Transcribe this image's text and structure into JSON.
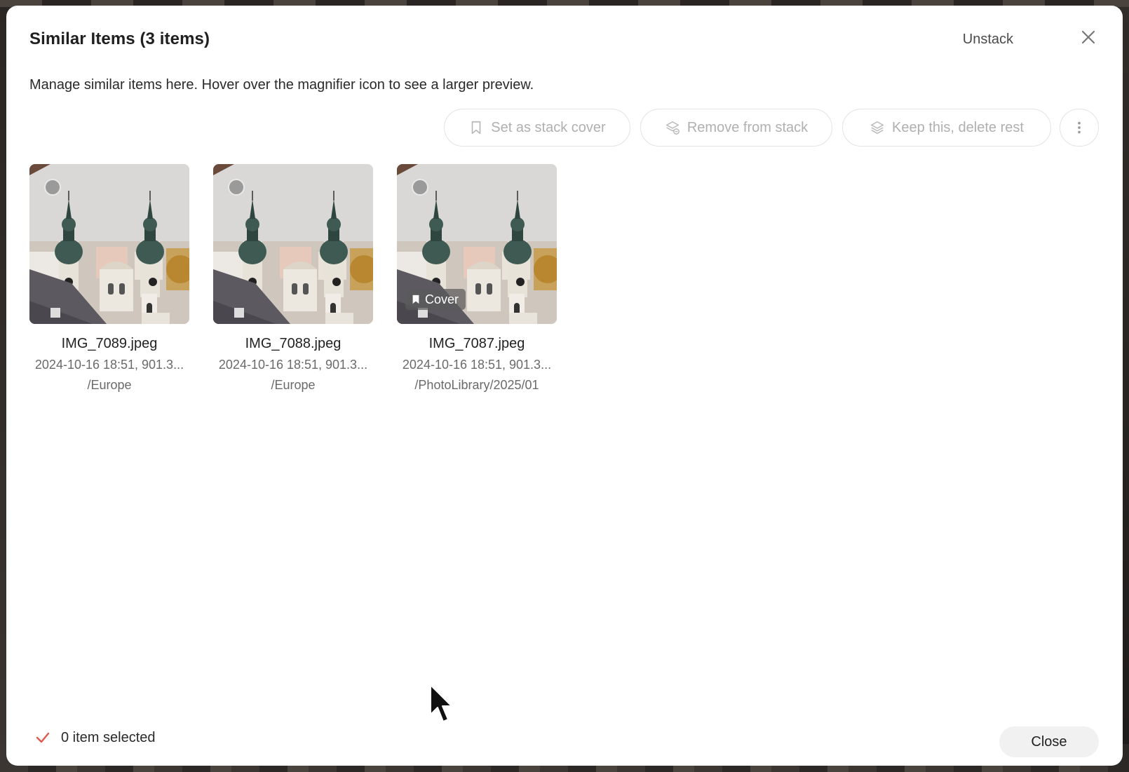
{
  "dialog": {
    "title": "Similar Items (3 items)",
    "unstack_label": "Unstack",
    "subtitle": "Manage similar items here. Hover over the magnifier icon to see a larger preview."
  },
  "actions": {
    "set_cover": "Set as stack cover",
    "remove": "Remove from stack",
    "keep_delete": "Keep this, delete rest"
  },
  "items": [
    {
      "name": "IMG_7089.jpeg",
      "meta": "2024-10-16 18:51, 901.3...",
      "path": "/Europe"
    },
    {
      "name": "IMG_7088.jpeg",
      "meta": "2024-10-16 18:51, 901.3...",
      "path": "/Europe"
    },
    {
      "name": "IMG_7087.jpeg",
      "meta": "2024-10-16 18:51, 901.3...",
      "path": "/PhotoLibrary/2025/01",
      "badge": "Cover"
    }
  ],
  "footer": {
    "selected_text": "0 item selected",
    "close_label": "Close"
  },
  "colors": {
    "check": "#e05a4f",
    "disabled_text": "#b0b0b0"
  }
}
